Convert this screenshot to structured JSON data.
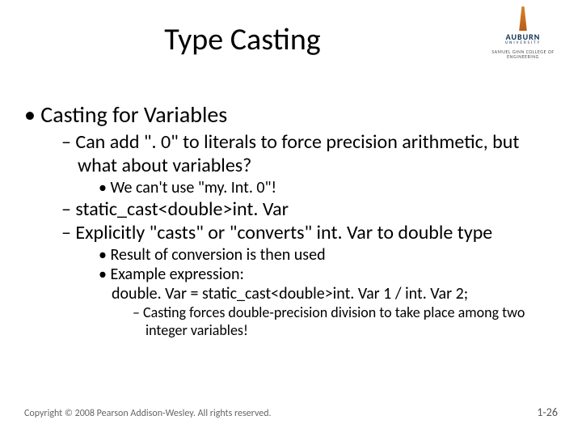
{
  "logo": {
    "name": "AUBURN",
    "sub": "UNIVERSITY",
    "college": "SAMUEL GINN COLLEGE OF ENGINEERING"
  },
  "title": "Type Casting",
  "bullets": {
    "l1": "Casting for Variables",
    "l2a": "Can add \". 0\" to literals to force precision arithmetic, but what about variables?",
    "l3a": "We can't use \"my. Int. 0\"!",
    "l2b": "static_cast<double>int. Var",
    "l2c": "Explicitly \"casts\" or \"converts\" int. Var to double type",
    "l3b": "Result of conversion is then used",
    "l3c_a": "Example expression:",
    "l3c_b": "double. Var = static_cast<double>int. Var 1 / int. Var 2;",
    "l4": "Casting forces double-precision division to take place among two integer variables!"
  },
  "footer": {
    "copyright": "Copyright © 2008 Pearson Addison-Wesley. All rights reserved.",
    "page": "1-26"
  }
}
